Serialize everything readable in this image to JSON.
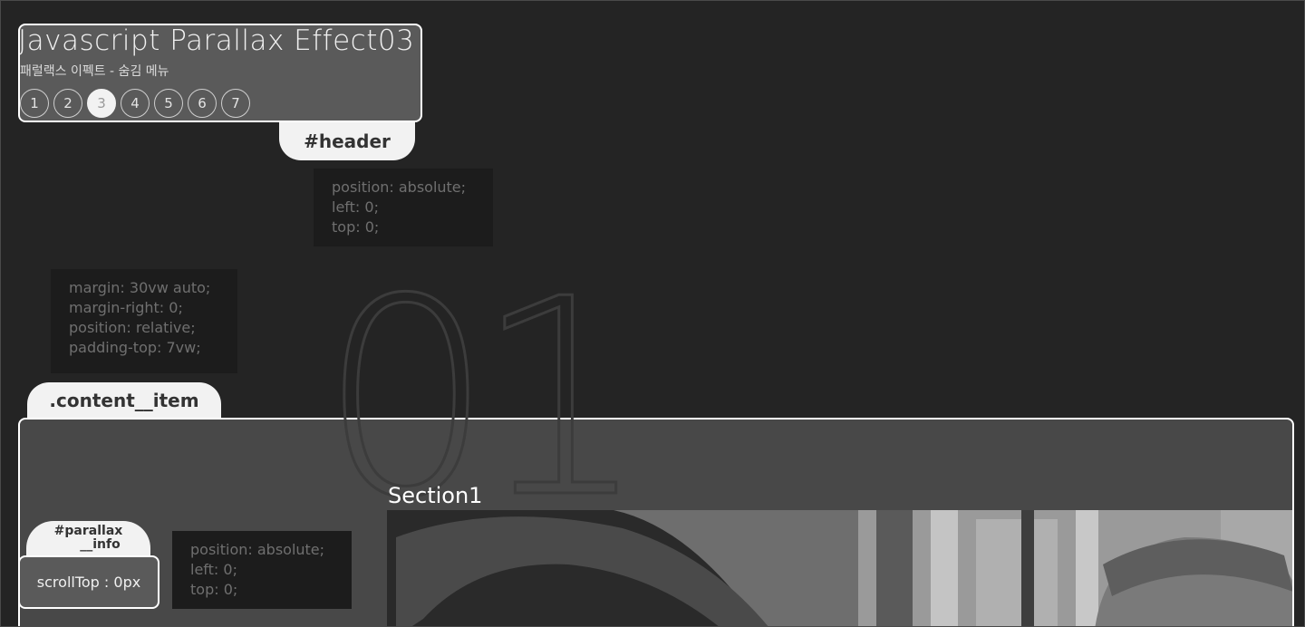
{
  "header": {
    "title": "Javascript Parallax Effect03",
    "subtitle": "패럴랙스 이펙트 - 숨김 메뉴",
    "pages": [
      "1",
      "2",
      "3",
      "4",
      "5",
      "6",
      "7"
    ],
    "active_page": "3",
    "tab_label": "#header",
    "css": [
      "position: absolute;",
      "left: 0;",
      "top: 0;"
    ]
  },
  "content": {
    "tab_label": ".content__item",
    "css": [
      "margin: 30vw auto;",
      "margin-right: 0;",
      "position: relative;",
      "padding-top: 7vw;"
    ],
    "big_number": "01",
    "section_title": "Section1"
  },
  "parallax_info": {
    "tab_label_line1": "#parallax",
    "tab_label_line2": "__info",
    "css": [
      "position: absolute;",
      "left: 0;",
      "top: 0;"
    ],
    "scroll_text": "scrollTop : 0px"
  },
  "colors": {
    "background": "#242424",
    "panel": "#5a5a5a",
    "accent": "#f2f2f2"
  }
}
